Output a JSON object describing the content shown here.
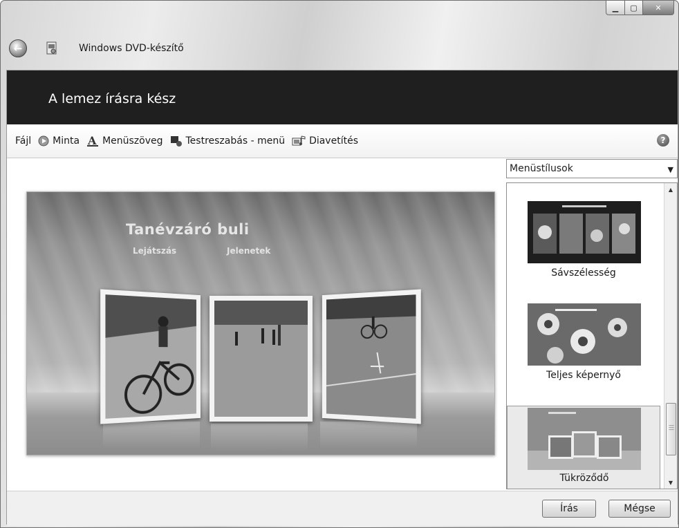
{
  "window": {
    "title": "Windows DVD-készítő",
    "caption_buttons": [
      "minimize-icon",
      "maximize-icon",
      "close-icon"
    ]
  },
  "banner": {
    "heading": "A lemez írásra kész"
  },
  "toolbar": {
    "file": "Fájl",
    "preview": "Minta",
    "menu_text": "Menüszöveg",
    "customize_menu": "Testreszabás - menü",
    "slideshow": "Diavetítés",
    "help_glyph": "?"
  },
  "preview": {
    "disc_title": "Tanévzáró buli",
    "play": "Lejátszás",
    "scenes": "Jelenetek"
  },
  "styles_panel": {
    "dropdown_value": "Menüstílusok",
    "items": [
      {
        "label": "Sávszélesség",
        "selected": false
      },
      {
        "label": "Teljes képernyő",
        "selected": false
      },
      {
        "label": "Tükröződő",
        "selected": true
      }
    ]
  },
  "buttons": {
    "write": "Írás",
    "cancel": "Mégse"
  }
}
